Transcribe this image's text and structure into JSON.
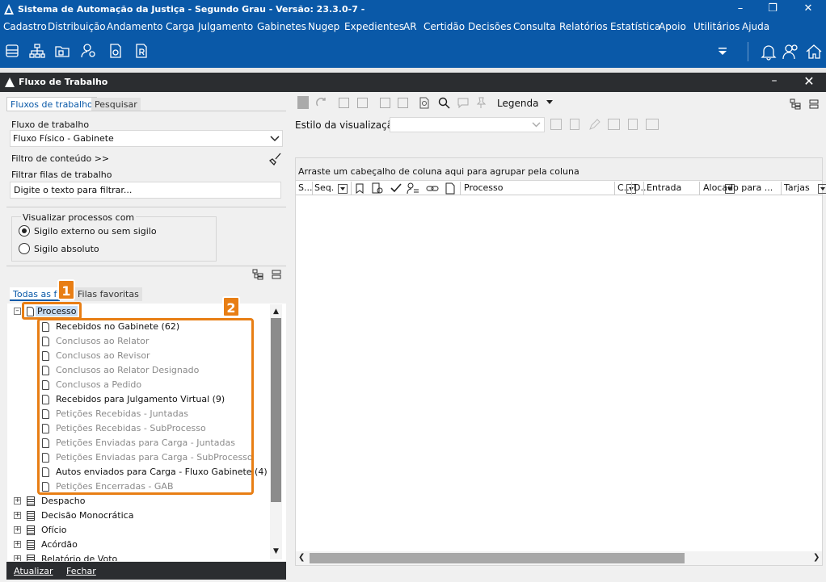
{
  "window": {
    "title": "Sistema de Automação da Justiça - Segundo Grau - Versão: 23.3.0-7 -"
  },
  "menu": [
    "Cadastro",
    "Distribuição",
    "Andamento",
    "Carga",
    "Julgamento",
    "Gabinetes",
    "Nugep",
    "Expedientes",
    "AR",
    "Certidão",
    "Decisões",
    "Consulta",
    "Relatórios",
    "Estatística",
    "Apoio",
    "Utilitários",
    "Ajuda"
  ],
  "panel": {
    "title": "Fluxo de Trabalho"
  },
  "left": {
    "tabs": [
      "Fluxos de trabalho",
      "Pesquisar"
    ],
    "flow_label": "Fluxo de trabalho",
    "flow_value": "Fluxo Físico - Gabinete",
    "content_filter": "Filtro de conteúdo >>",
    "queue_filter_label": "Filtrar filas de trabalho",
    "queue_filter_placeholder": "Digite o texto para filtrar...",
    "visualize_group": "Visualizar processos com",
    "radio1": "Sigilo externo ou sem sigilo",
    "radio2": "Sigilo absoluto",
    "subtabs": [
      "Todas as f",
      "Filas favoritas"
    ],
    "root": "Processo",
    "queues": [
      {
        "label": "Recebidos no Gabinete (62)",
        "active": true
      },
      {
        "label": "Conclusos ao Relator",
        "active": false
      },
      {
        "label": "Conclusos ao Revisor",
        "active": false
      },
      {
        "label": "Conclusos ao Relator Designado",
        "active": false
      },
      {
        "label": "Conclusos a Pedido",
        "active": false
      },
      {
        "label": "Recebidos para Julgamento Virtual (9)",
        "active": true
      },
      {
        "label": "Petições Recebidas - Juntadas",
        "active": false
      },
      {
        "label": "Petições Recebidas - SubProcesso",
        "active": false
      },
      {
        "label": "Petições Enviadas para Carga - Juntadas",
        "active": false
      },
      {
        "label": "Petições Enviadas para Carga - SubProcesso",
        "active": false
      },
      {
        "label": "Autos enviados para Carga - Fluxo Gabinete (4)",
        "active": true
      },
      {
        "label": "Petições Encerradas  - GAB",
        "active": false
      }
    ],
    "others": [
      "Despacho",
      "Decisão Monocrática",
      "Ofício",
      "Acórdão",
      "Relatório de Voto"
    ],
    "badges": [
      "1",
      "2"
    ],
    "footer": [
      "Atualizar",
      "Fechar"
    ]
  },
  "right": {
    "legend": "Legenda",
    "view_style_label": "Estilo da visualização",
    "group_hint": "Arraste um cabeçalho de coluna aqui para agrupar pela coluna",
    "columns": [
      "S...",
      "Seq.",
      "Processo",
      "C...",
      "D...",
      "Entrada",
      "Alocado para ...",
      "Tarjas"
    ]
  },
  "colors": {
    "blue": "#0a59a8",
    "accent": "#e87e14",
    "dark": "#2b2d30"
  }
}
